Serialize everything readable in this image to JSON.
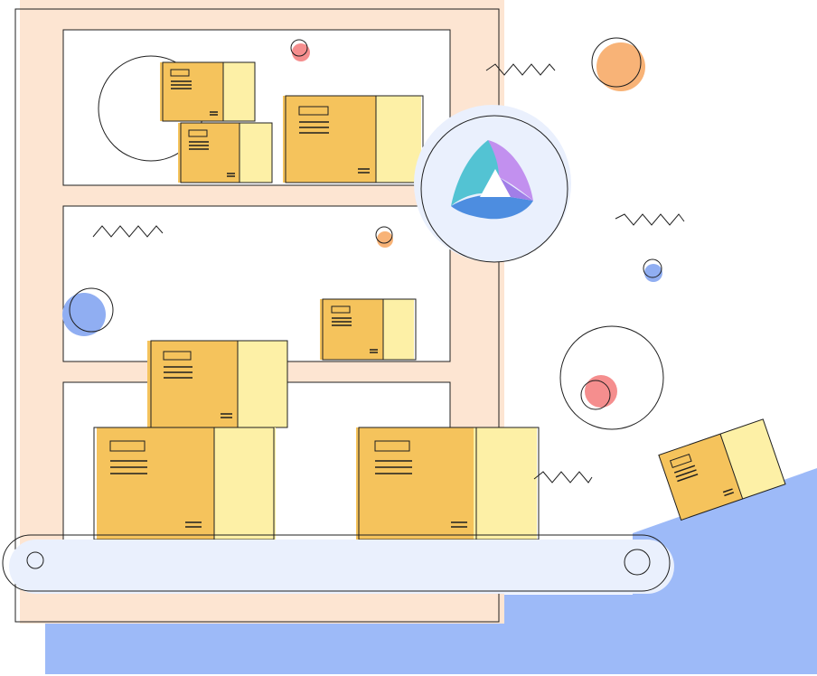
{
  "scene": {
    "subject": "warehouse-shelf-conveyor-illustration"
  },
  "palette": {
    "shelf_fill": "#fde5d2",
    "line": "#1f1f1f",
    "box_main": "#f5c35c",
    "box_side": "#fdf0a6",
    "blue_ramp": "#9dbaf8",
    "belt_fill": "#eaf0fd",
    "logo_circle": "#eaf0fd",
    "dot_red": "#f58e8e",
    "dot_orange": "#f8b377",
    "dot_blue": "#90aef2",
    "logo_purple": "#c290ef",
    "logo_teal": "#53c3d3",
    "logo_blue": "#4d8de0"
  },
  "icons": {
    "logo": "triangular-swirl-logo-icon"
  }
}
